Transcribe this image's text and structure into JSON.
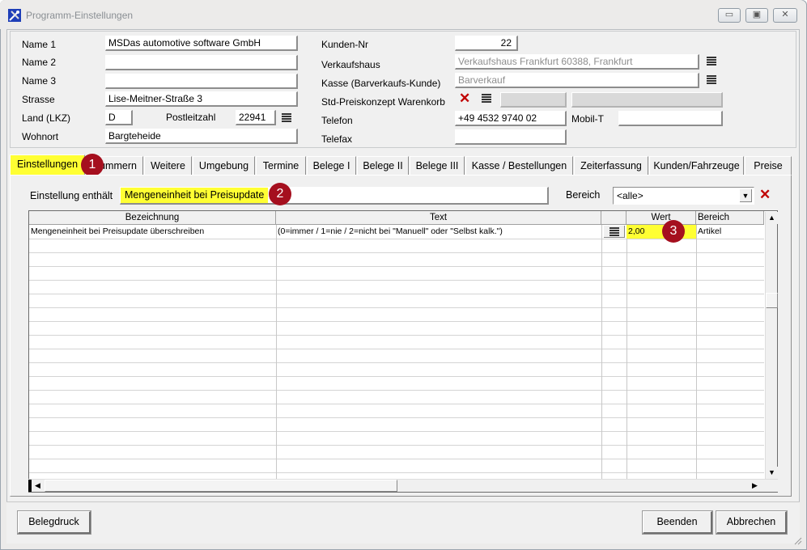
{
  "window": {
    "title": "Programm-Einstellungen",
    "minimize": "▭",
    "maximize": "▣",
    "close": "✕"
  },
  "header": {
    "name1_label": "Name 1",
    "name1": "MSDas automotive software GmbH",
    "name2_label": "Name 2",
    "name2": "",
    "name3_label": "Name 3",
    "name3": "",
    "strasse_label": "Strasse",
    "strasse": "Lise-Meitner-Straße 3",
    "land_label": "Land (LKZ)",
    "land": "D",
    "plz_label": "Postleitzahl",
    "plz": "22941",
    "wohnort_label": "Wohnort",
    "wohnort": "Bargteheide",
    "kundennr_label": "Kunden-Nr",
    "kundennr": "22",
    "verkaufshaus_label": "Verkaufshaus",
    "verkaufshaus": "Verkaufshaus Frankfurt 60388, Frankfurt",
    "kasse_label": "Kasse (Barverkaufs-Kunde)",
    "kasse": "Barverkauf",
    "preiskonzept_label": "Std-Preiskonzept Warenkorb",
    "telefon_label": "Telefon",
    "telefon": "+49 4532 9740 02",
    "mobil_label": "Mobil-T",
    "mobil": "",
    "telefax_label": "Telefax",
    "telefax": ""
  },
  "tabs": [
    {
      "label": "Einstellungen",
      "selected": true
    },
    {
      "label": "Nummern"
    },
    {
      "label": "Weitere"
    },
    {
      "label": "Umgebung"
    },
    {
      "label": "Termine"
    },
    {
      "label": "Belege I"
    },
    {
      "label": "Belege II"
    },
    {
      "label": "Belege III"
    },
    {
      "label": "Kasse / Bestellungen"
    },
    {
      "label": "Zeiterfassung"
    },
    {
      "label": "Kunden/Fahrzeuge"
    },
    {
      "label": "Preise"
    }
  ],
  "filter": {
    "label": "Einstellung enthält",
    "value": "Mengeneinheit bei Preisupdate",
    "bereich_label": "Bereich",
    "bereich_value": "<alle>"
  },
  "badges": {
    "b1": "1",
    "b2": "2",
    "b3": "3"
  },
  "grid": {
    "columns": {
      "bezeichnung": "Bezeichnung",
      "text": "Text",
      "wert": "Wert",
      "bereich": "Bereich"
    },
    "rows": [
      {
        "bezeichnung": "Mengeneinheit bei Preisupdate überschreiben",
        "text": "(0=immer / 1=nie / 2=nicht bei \"Manuell\" oder \"Selbst kalk.\")",
        "wert": "2,00",
        "bereich": "Artikel"
      }
    ]
  },
  "footer": {
    "belegdruck": "Belegdruck",
    "beenden": "Beenden",
    "abbrechen": "Abbrechen"
  },
  "colors": {
    "highlight": "#ffff33",
    "badge": "#a50f1e",
    "delete": "#c00000"
  }
}
